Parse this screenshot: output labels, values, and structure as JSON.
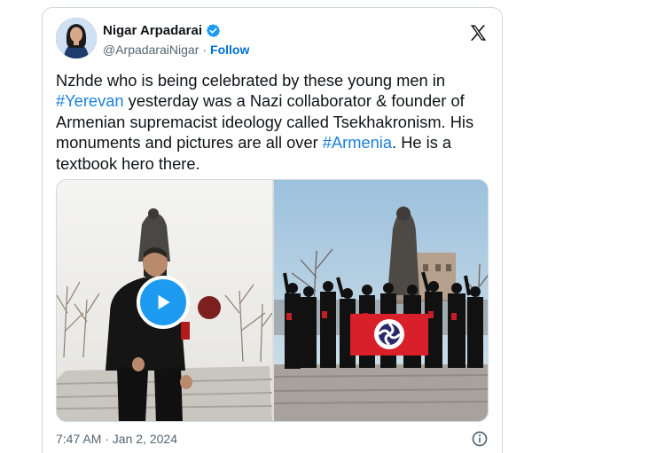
{
  "author": {
    "display_name": "Nigar Arpadarai",
    "handle": "@ArpadaraiNigar",
    "separator": "·",
    "follow_label": "Follow"
  },
  "tweet": {
    "text_1": "Nzhde who is being celebrated by these young men in ",
    "hashtag_1": "#Yerevan",
    "text_2": " yesterday was a Nazi collaborator & founder of Armenian supremacist ideology called Tsekhakronism. His monuments and pictures are all over ",
    "hashtag_2": "#Armenia",
    "text_3": ". He is a textbook hero there."
  },
  "footer": {
    "timestamp": "7:47 AM · Jan 2, 2024"
  },
  "icons": {
    "verified": "verified-badge-icon",
    "platform": "x-logo-icon",
    "play": "play-icon",
    "info": "info-icon"
  },
  "colors": {
    "link": "#1d7fd6",
    "verified": "#1d9bf0",
    "play_button": "#1d9bf0",
    "secondary_text": "#536471",
    "border": "#cfd9de"
  }
}
